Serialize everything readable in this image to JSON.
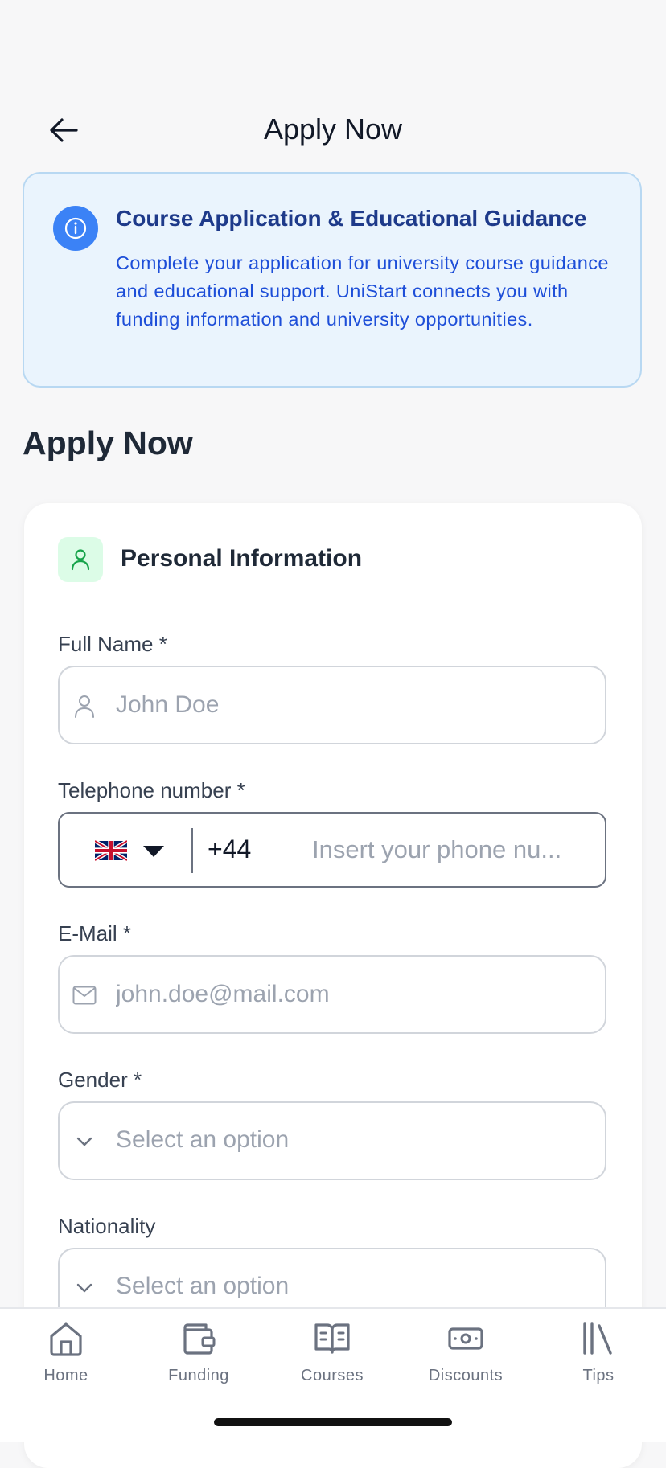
{
  "header": {
    "title": "Apply Now"
  },
  "info_box": {
    "title": "Course Application & Educational Guidance",
    "body": "Complete your application for university course guidance and educational support. UniStart connects you with funding information and university opportunities."
  },
  "section_heading": "Apply Now",
  "personal_info": {
    "title": "Personal Information",
    "full_name": {
      "label": "Full Name *",
      "placeholder": "John Doe",
      "value": ""
    },
    "telephone": {
      "label": "Telephone number *",
      "country_flag": "uk-flag-icon",
      "dial_code": "+44",
      "placeholder": "Insert your phone nu...",
      "value": ""
    },
    "email": {
      "label": "E-Mail *",
      "placeholder": "john.doe@mail.com",
      "value": ""
    },
    "gender": {
      "label": "Gender *",
      "selected": "Select an option"
    },
    "nationality": {
      "label": "Nationality",
      "selected": "Select an option"
    }
  },
  "bottom_nav": {
    "items": [
      {
        "label": "Home",
        "icon": "home-icon"
      },
      {
        "label": "Funding",
        "icon": "wallet-icon"
      },
      {
        "label": "Courses",
        "icon": "book-icon"
      },
      {
        "label": "Discounts",
        "icon": "cash-icon"
      },
      {
        "label": "Tips",
        "icon": "library-icon"
      }
    ]
  },
  "colors": {
    "accent_blue": "#3b82f6",
    "info_bg": "#eaf4fd",
    "info_title": "#1e3a8a",
    "info_text": "#1d4ed8",
    "green_icon_bg": "#dcfce7",
    "green_icon": "#16a34a",
    "nav_gray": "#6b7280"
  }
}
